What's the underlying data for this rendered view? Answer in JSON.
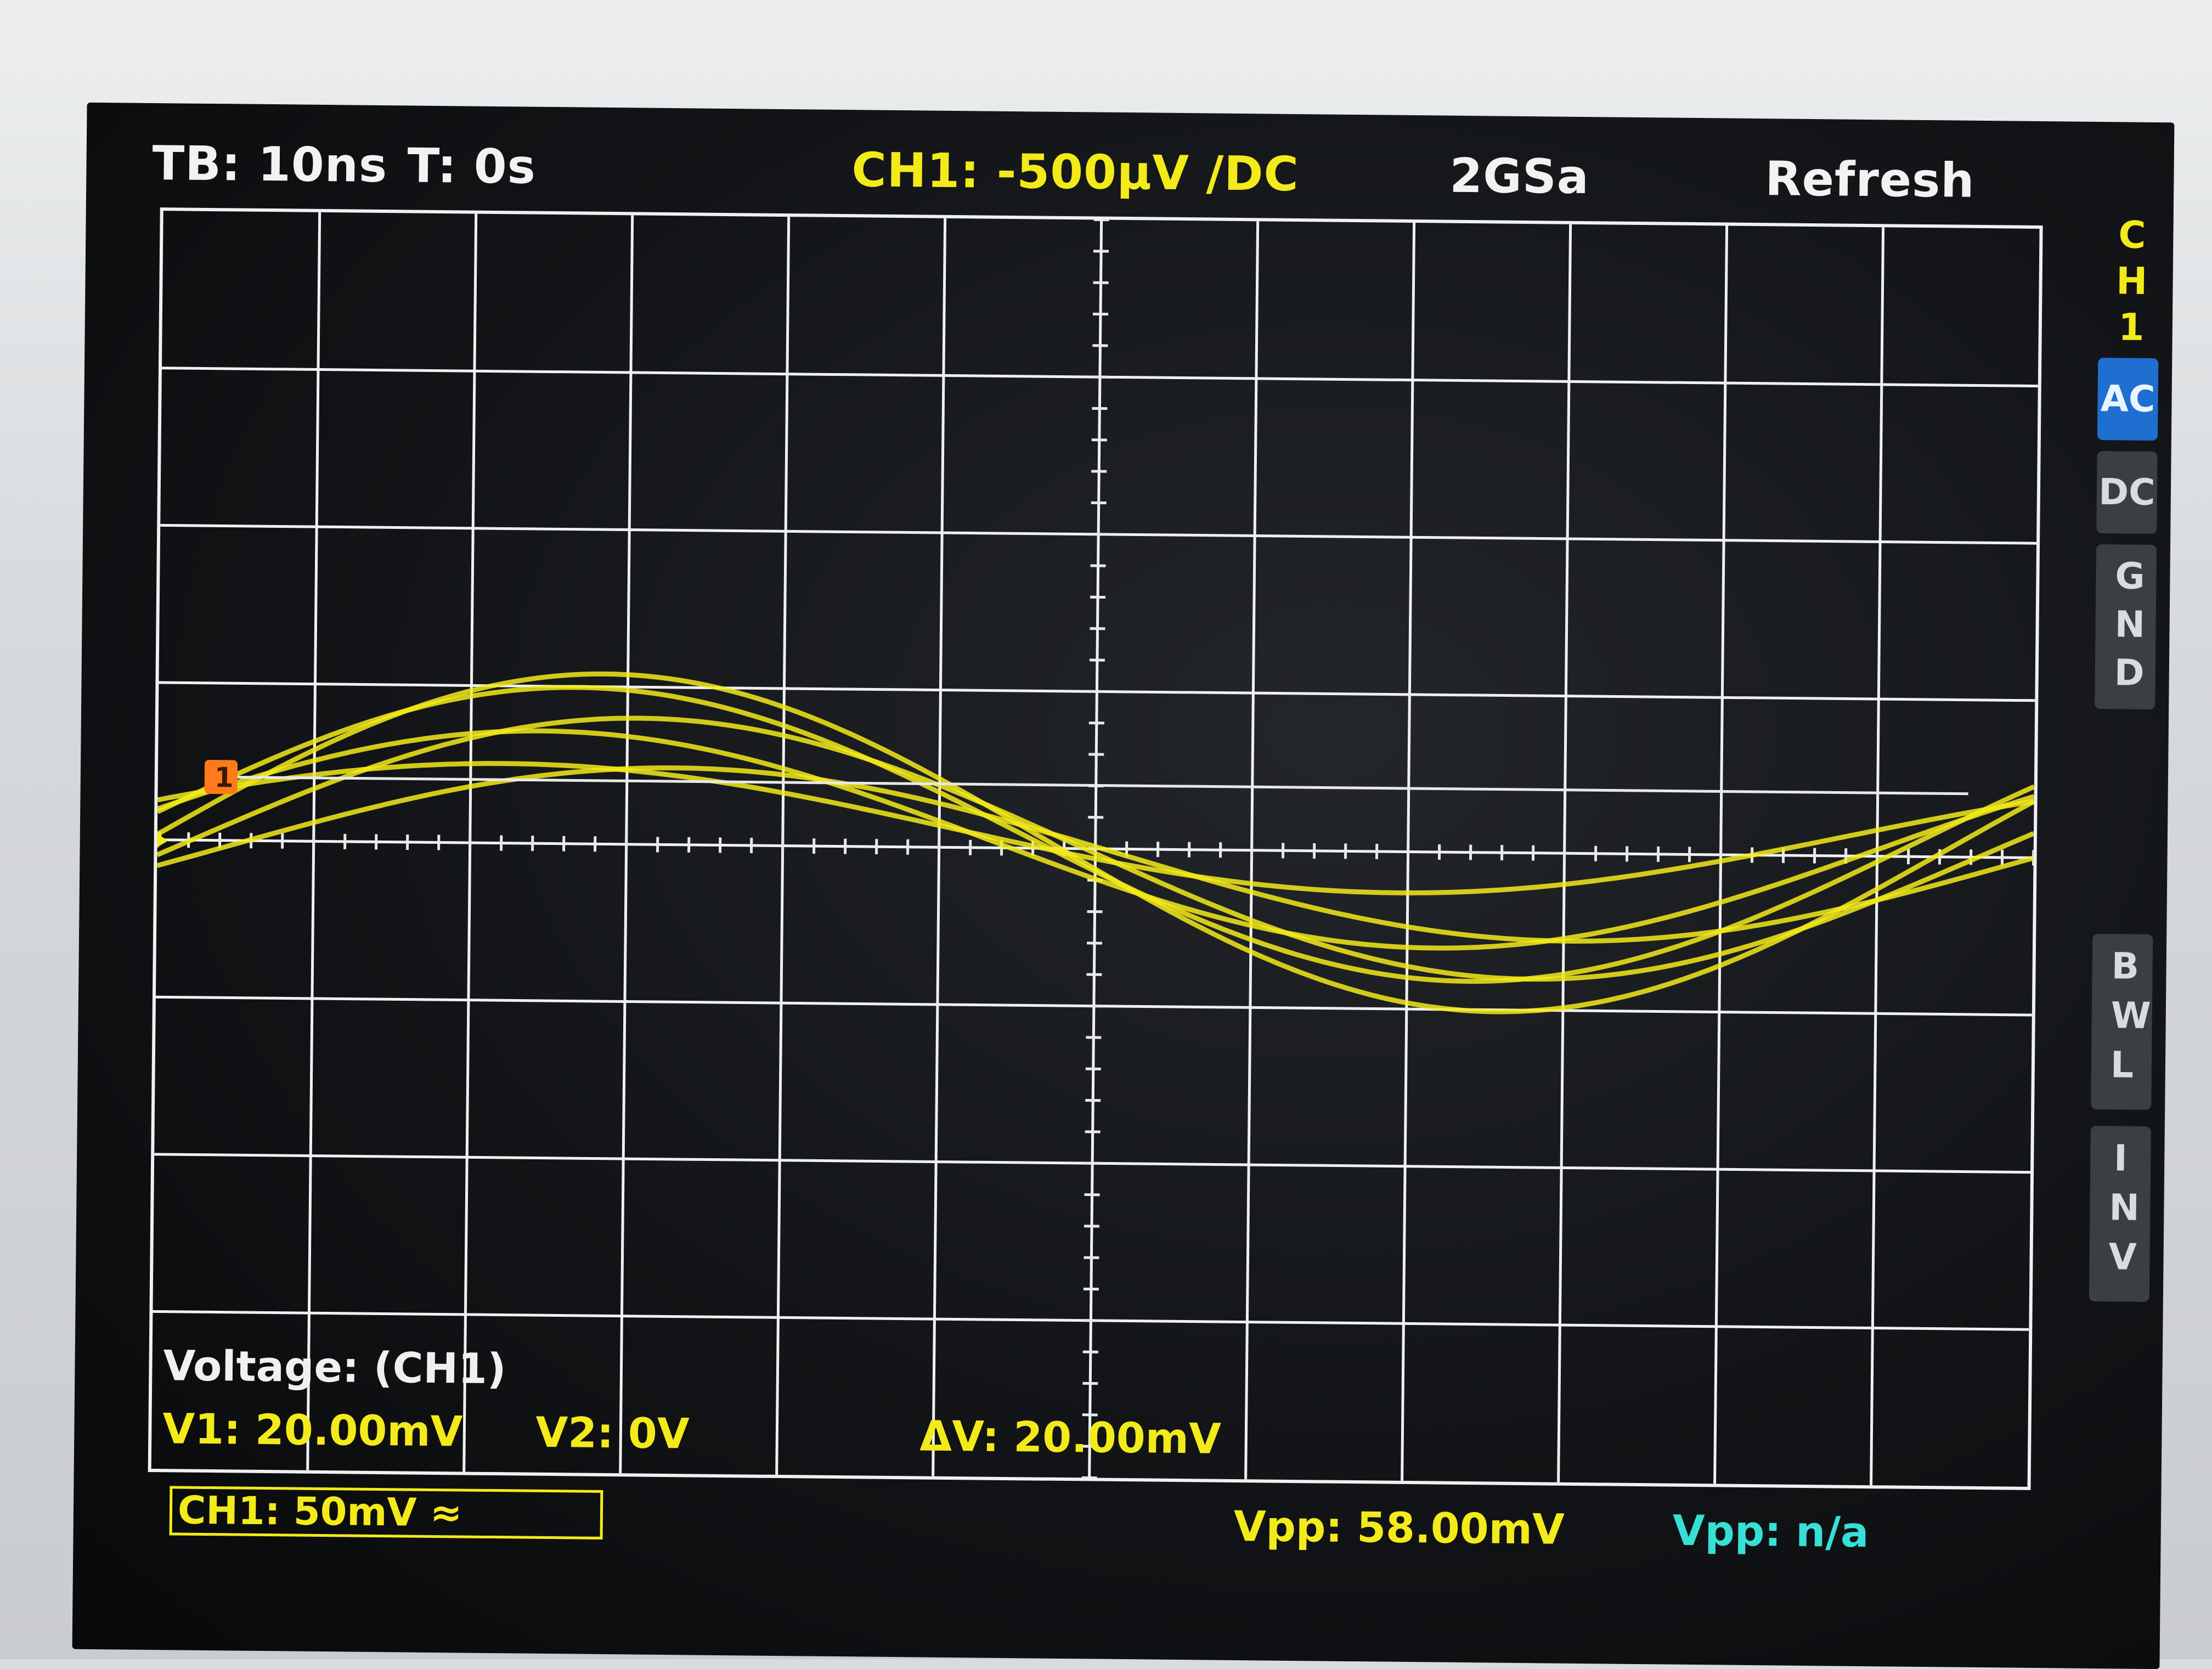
{
  "header": {
    "timebase": "TB: 10ns",
    "trigger_time": "T: 0s",
    "channel": "CH1: -500µV /DC",
    "sample_rate": "2GSa",
    "mode": "Refresh"
  },
  "side_menu": {
    "channel_label": "CH1",
    "buttons": [
      {
        "label": "AC",
        "active": true
      },
      {
        "label": "DC",
        "active": false
      },
      {
        "label": "GND",
        "active": false
      },
      {
        "label": "BWL",
        "active": false
      },
      {
        "label": "INV",
        "active": false
      }
    ]
  },
  "markers": {
    "channel_marker": "1",
    "trigger_marker": "1"
  },
  "measurement": {
    "title": "Voltage: (CH1)",
    "v1": "V1: 20.00mV",
    "v2": "V2: 0V",
    "delta_v": "ΔV: 20.00mV"
  },
  "status_bar": {
    "channel_scale": "CH1: 50mV ≈",
    "vpp_ch1": "Vpp: 58.00mV",
    "vpp_ch2": "Vpp: n/a"
  },
  "colors": {
    "trace": "#f3ea1a",
    "grid": "#eef0f2",
    "cyan_text": "#37e0d6",
    "active_button": "#1e6fd0",
    "trigger_marker": "#ff7a1a"
  }
}
